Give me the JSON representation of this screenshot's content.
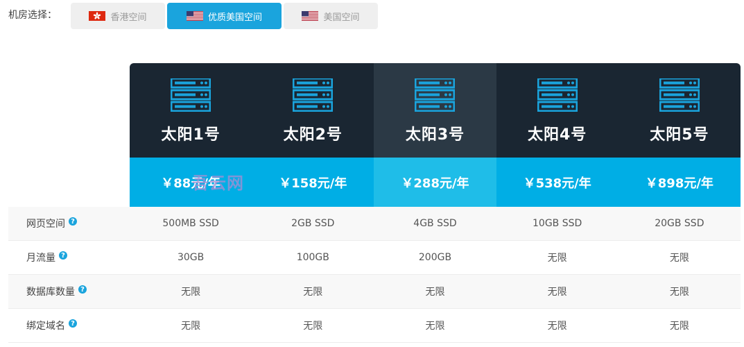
{
  "selector": {
    "label": "机房选择：",
    "tabs": [
      {
        "label": "香港空间",
        "flag": "hk-flag-icon",
        "active": false
      },
      {
        "label": "优质美国空间",
        "flag": "us-flag-icon",
        "active": true
      },
      {
        "label": "美国空间",
        "flag": "us-flag-icon",
        "active": false
      }
    ]
  },
  "plans": [
    {
      "name": "太阳1号",
      "price": "￥88元/年",
      "icon": "server-icon",
      "featured": false
    },
    {
      "name": "太阳2号",
      "price": "￥158元/年",
      "icon": "server-icon",
      "featured": false
    },
    {
      "name": "太阳3号",
      "price": "￥288元/年",
      "icon": "server-icon",
      "featured": true
    },
    {
      "name": "太阳4号",
      "price": "￥538元/年",
      "icon": "server-icon",
      "featured": false
    },
    {
      "name": "太阳5号",
      "price": "￥898元/年",
      "icon": "server-icon",
      "featured": false
    }
  ],
  "features": [
    {
      "name": "网页空间",
      "values": [
        "500MB SSD",
        "2GB SSD",
        "4GB SSD",
        "10GB SSD",
        "20GB SSD"
      ]
    },
    {
      "name": "月流量",
      "values": [
        "30GB",
        "100GB",
        "200GB",
        "无限",
        "无限"
      ]
    },
    {
      "name": "数据库数量",
      "values": [
        "无限",
        "无限",
        "无限",
        "无限",
        "无限"
      ]
    },
    {
      "name": "绑定域名",
      "values": [
        "无限",
        "无限",
        "无限",
        "无限",
        "无限"
      ]
    }
  ],
  "help_glyph": "?",
  "watermark": "吾云网",
  "colors": {
    "accent": "#1aa4dd",
    "header_dark": "#1a2632",
    "header_featured": "#2b3945",
    "price_band": "#00aee5",
    "price_featured": "#1fbde8",
    "server_icon": "#1aa4dd"
  }
}
